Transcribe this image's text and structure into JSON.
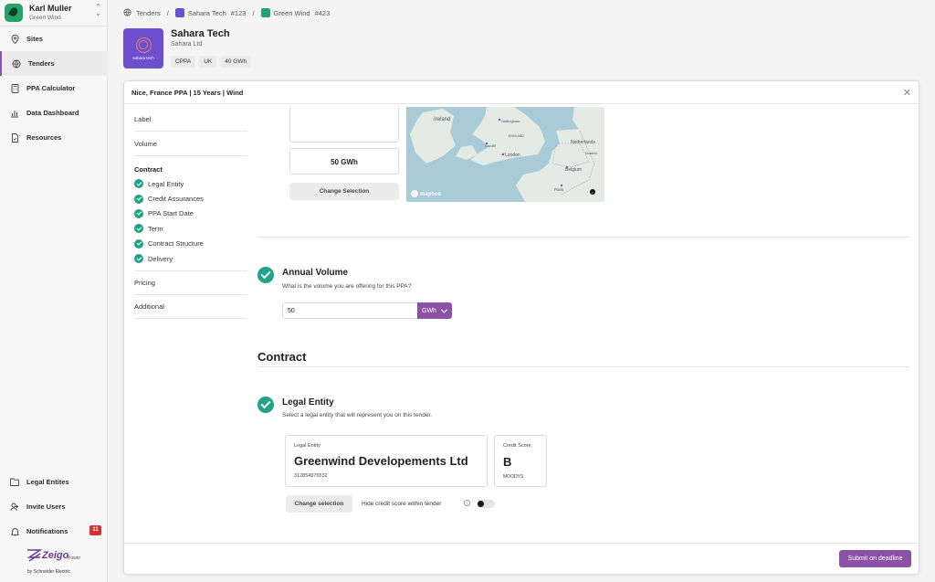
{
  "user": {
    "name": "Karl Muller",
    "org": "Green Wind"
  },
  "nav": {
    "sites": "Sites",
    "tenders": "Tenders",
    "ppa_calculator": "PPA Calculator",
    "data_dashboard": "Data Dashboard",
    "resources": "Resources",
    "legal_entities": "Legal Entites",
    "invite_users": "Invite Users",
    "notifications": "Notifications",
    "notifications_count": "11"
  },
  "brand": {
    "name": "Zeigo",
    "suffix": "Power",
    "by": "by Schneider Electric"
  },
  "breadcrumb": {
    "root": "Tenders",
    "company": "Sahara Tech",
    "company_num": "#123",
    "tender": "Green Wind",
    "tender_num": "#423"
  },
  "company": {
    "logo_text": "sahara tech",
    "name": "Sahara Tech",
    "legal_name": "Sahara Ltd",
    "tags": [
      "CPPA",
      "UK",
      "40 GWh"
    ]
  },
  "modal": {
    "title": "Nice, France PPA | 15 Years | Wind",
    "steps": {
      "label": "Label",
      "volume": "Volume",
      "contract": "Contract",
      "contract_items": [
        "Legal Entity",
        "Credit Assurances",
        "PPA Start Date",
        "Term",
        "Contract Structure",
        "Delivery"
      ],
      "pricing": "Pricing",
      "additional": "Additional"
    },
    "site": {
      "volume": "50 GWh",
      "change_label": "Change Selection",
      "map_labels": [
        "Ireland",
        "Nottingham",
        "ENGLAND",
        "Netherlands",
        "Cardiff",
        "London",
        "Dusseld",
        "Belgium",
        "Paris"
      ],
      "map_attribution": "mapbox"
    },
    "annual_volume": {
      "title": "Annual Volume",
      "question": "What is the volume you are offering for this PPA?",
      "value": "50",
      "unit": "GWh"
    },
    "contract_title": "Contract",
    "legal_entity": {
      "title": "Legal Entity",
      "question": "Select a legal entity that will represent you on this tender.",
      "card_label": "Legal Entity",
      "name": "Greenwind Developements Ltd",
      "number": "312854976532",
      "credit_label": "Credit Score",
      "credit_value": "B",
      "credit_agency": "MOODYS",
      "change_label": "Change selection",
      "hide_label": "Hide credit score within tender"
    },
    "submit_label": "Submit on deadline"
  },
  "colors": {
    "accent": "#8a52a6",
    "success": "#20a38a",
    "logo_bg": "#6c4fcf",
    "brand_green": "#22a36b"
  }
}
